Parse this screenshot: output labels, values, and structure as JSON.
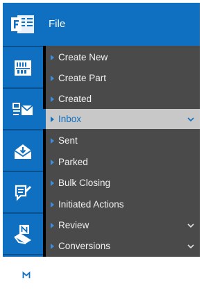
{
  "header": {
    "title": "File",
    "logo_icon": "outlook-icon"
  },
  "rail": {
    "icons": [
      "file-cabinet-icon",
      "document-mail-icon",
      "inbox-tray-icon",
      "compose-note-icon",
      "new-mail-icon",
      "move-mail-icon"
    ]
  },
  "menu": {
    "items": [
      {
        "label": "Create New",
        "active": false,
        "has_chevron": false
      },
      {
        "label": "Create Part",
        "active": false,
        "has_chevron": false
      },
      {
        "label": "Created",
        "active": false,
        "has_chevron": false
      },
      {
        "label": "Inbox",
        "active": true,
        "has_chevron": true
      },
      {
        "label": "Sent",
        "active": false,
        "has_chevron": false
      },
      {
        "label": "Parked",
        "active": false,
        "has_chevron": false
      },
      {
        "label": "Bulk Closing",
        "active": false,
        "has_chevron": false
      },
      {
        "label": "Initiated Actions",
        "active": false,
        "has_chevron": false
      },
      {
        "label": "Review",
        "active": false,
        "has_chevron": true
      },
      {
        "label": "Conversions",
        "active": false,
        "has_chevron": true
      }
    ]
  },
  "colors": {
    "accent": "#0f6fc0",
    "menu_bg": "#4a4a4a",
    "active_bg": "#c8c8c8"
  }
}
